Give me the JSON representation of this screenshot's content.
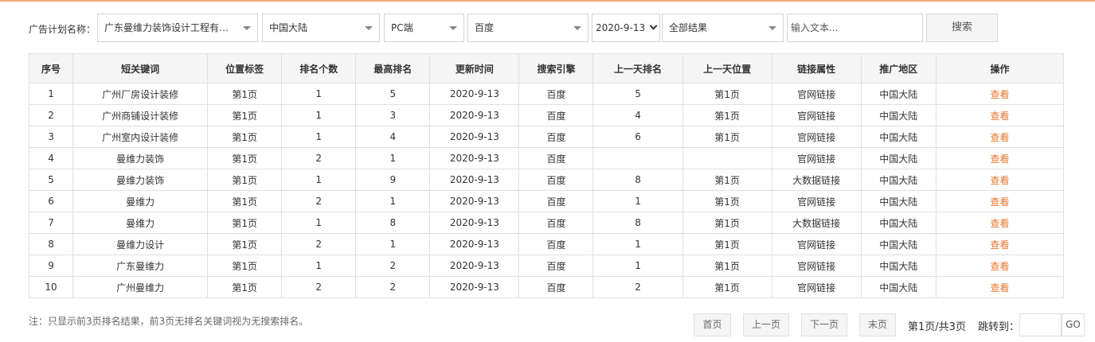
{
  "filters": {
    "plan_label": "广告计划名称：",
    "plan_value": "广东曼维力装饰设计工程有限...",
    "region_value": "中国大陆",
    "device_value": "PC端",
    "engine_value": "百度",
    "date_value": "2020-9-13",
    "result_value": "全部结果",
    "search_placeholder": "输入文本...",
    "search_button": "搜索"
  },
  "table": {
    "headers": [
      "序号",
      "短关键词",
      "位置标签",
      "排名个数",
      "最高排名",
      "更新时间",
      "搜索引擎",
      "上一天排名",
      "上一天位置",
      "链接属性",
      "推广地区",
      "操作"
    ],
    "rows": [
      [
        "1",
        "广州厂房设计装修",
        "第1页",
        "1",
        "5",
        "2020-9-13",
        "百度",
        "5",
        "第1页",
        "官网链接",
        "中国大陆",
        "查看"
      ],
      [
        "2",
        "广州商铺设计装修",
        "第1页",
        "1",
        "3",
        "2020-9-13",
        "百度",
        "4",
        "第1页",
        "官网链接",
        "中国大陆",
        "查看"
      ],
      [
        "3",
        "广州室内设计装修",
        "第1页",
        "1",
        "4",
        "2020-9-13",
        "百度",
        "6",
        "第1页",
        "官网链接",
        "中国大陆",
        "查看"
      ],
      [
        "4",
        "曼维力装饰",
        "第1页",
        "2",
        "1",
        "2020-9-13",
        "百度",
        "",
        "",
        "官网链接",
        "中国大陆",
        "查看"
      ],
      [
        "5",
        "曼维力装饰",
        "第1页",
        "1",
        "9",
        "2020-9-13",
        "百度",
        "8",
        "第1页",
        "大数据链接",
        "中国大陆",
        "查看"
      ],
      [
        "6",
        "曼维力",
        "第1页",
        "2",
        "1",
        "2020-9-13",
        "百度",
        "1",
        "第1页",
        "官网链接",
        "中国大陆",
        "查看"
      ],
      [
        "7",
        "曼维力",
        "第1页",
        "1",
        "8",
        "2020-9-13",
        "百度",
        "8",
        "第1页",
        "大数据链接",
        "中国大陆",
        "查看"
      ],
      [
        "8",
        "曼维力设计",
        "第1页",
        "2",
        "1",
        "2020-9-13",
        "百度",
        "1",
        "第1页",
        "官网链接",
        "中国大陆",
        "查看"
      ],
      [
        "9",
        "广东曼维力",
        "第1页",
        "1",
        "2",
        "2020-9-13",
        "百度",
        "1",
        "第1页",
        "官网链接",
        "中国大陆",
        "查看"
      ],
      [
        "10",
        "广州曼维力",
        "第1页",
        "2",
        "2",
        "2020-9-13",
        "百度",
        "2",
        "第1页",
        "官网链接",
        "中国大陆",
        "查看"
      ]
    ]
  },
  "note": "注：只显示前3页排名结果，前3页无排名关键词视为无搜索排名。",
  "pagination": {
    "first": "首页",
    "prev": "上一页",
    "next": "下一页",
    "last": "末页",
    "page_info": "第1页/共3页",
    "jump_label": "跳转到：",
    "go": "GO"
  },
  "colors": {
    "accent": "#e8762c",
    "header_bg": "#f5f5f5",
    "border": "#e0e0e0"
  }
}
